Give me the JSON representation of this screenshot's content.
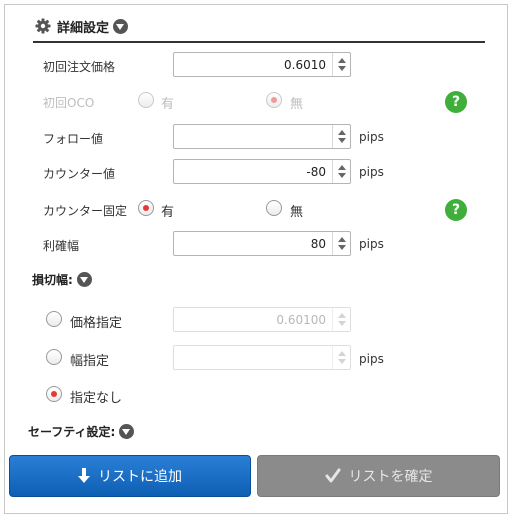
{
  "header": {
    "title": "詳細設定"
  },
  "rows": {
    "initial_price": {
      "label": "初回注文価格",
      "value": "0.6010"
    },
    "initial_oco": {
      "label": "初回OCO",
      "opt_yes": "有",
      "opt_no": "無",
      "selected": "無"
    },
    "follow": {
      "label": "フォロー値",
      "value": "",
      "unit": "pips"
    },
    "counter": {
      "label": "カウンター値",
      "value": "-80",
      "unit": "pips"
    },
    "counter_fixed": {
      "label": "カウンター固定",
      "opt_yes": "有",
      "opt_no": "無",
      "selected": "有"
    },
    "profit": {
      "label": "利確幅",
      "value": "80",
      "unit": "pips"
    }
  },
  "stop_loss": {
    "title": "損切幅:",
    "price_label": "価格指定",
    "price_value": "0.60100",
    "width_label": "幅指定",
    "width_value": "",
    "width_unit": "pips",
    "none_label": "指定なし",
    "selected": "指定なし"
  },
  "safety": {
    "title": "セーフティ設定:"
  },
  "buttons": {
    "add": "リストに追加",
    "confirm": "リストを確定"
  },
  "colors": {
    "primary": "#0d5fb3",
    "radio_selected": "#e53935",
    "help": "#3fae3a",
    "disabled_button": "#8b8b8b"
  }
}
